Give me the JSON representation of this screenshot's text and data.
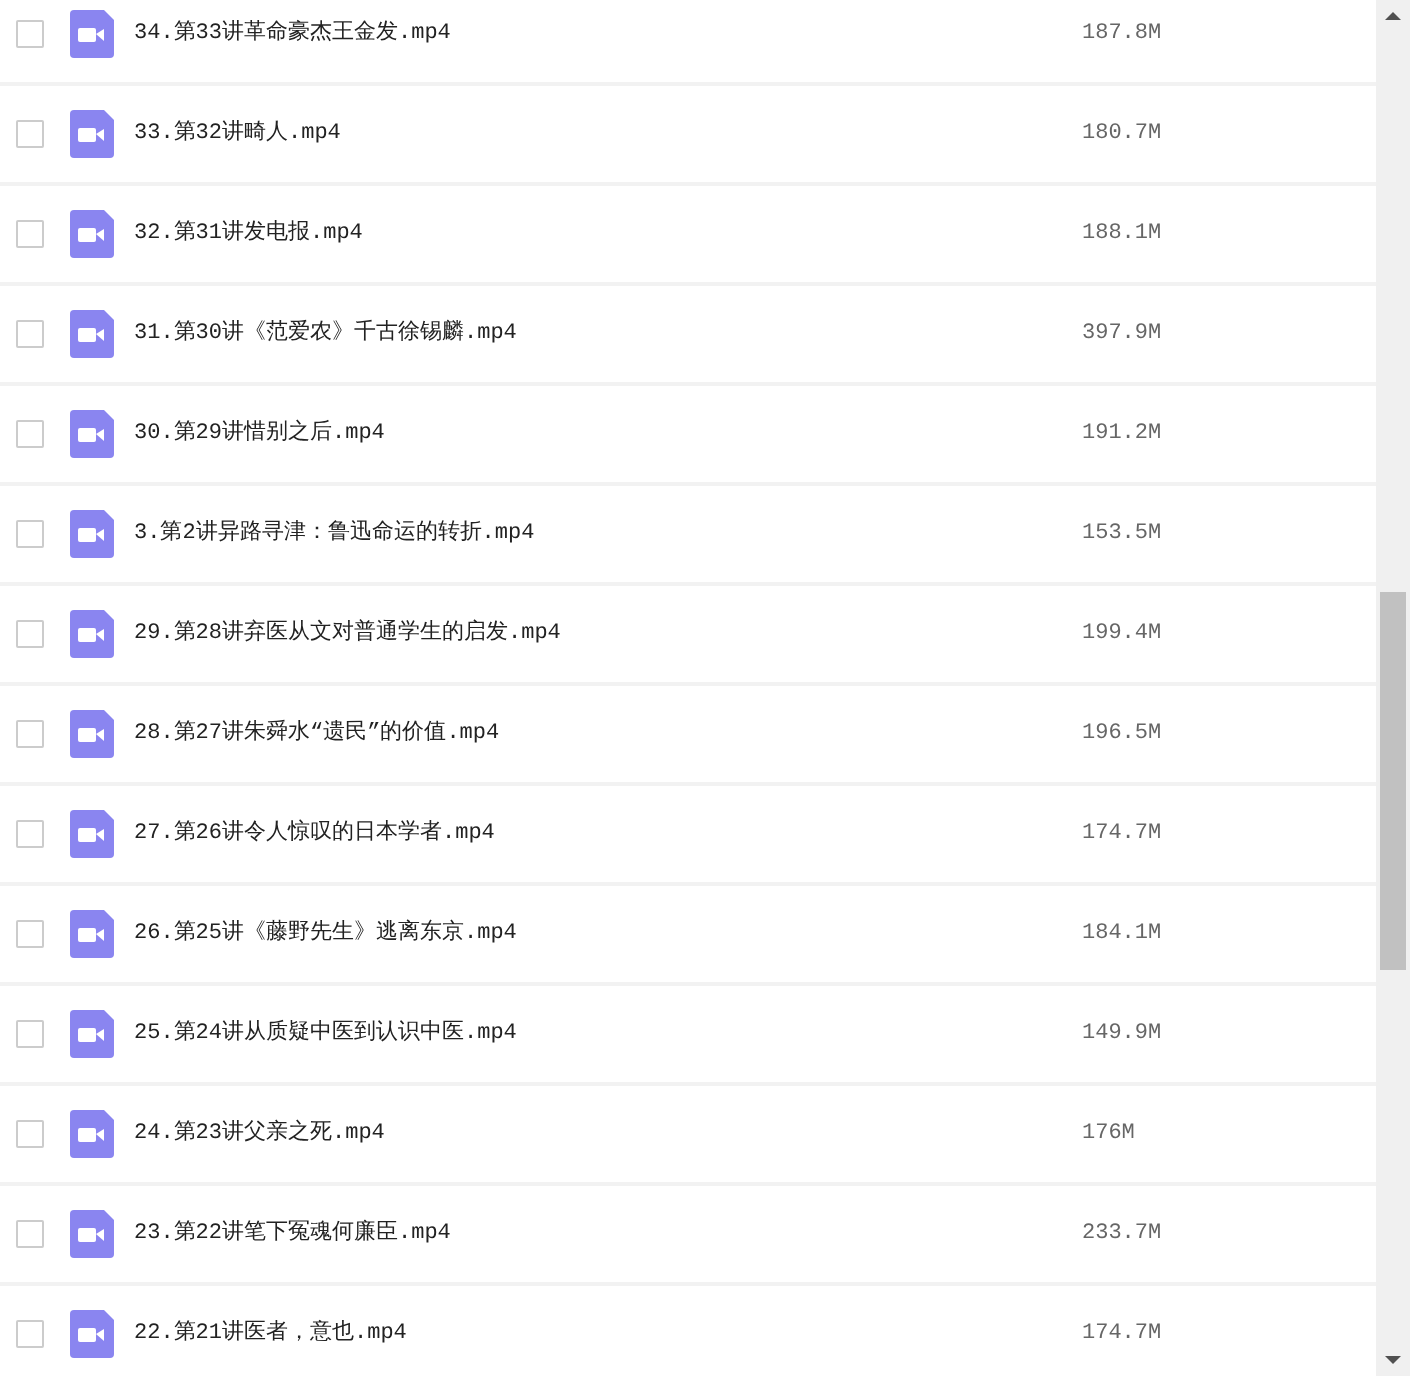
{
  "files": [
    {
      "name": "34.第33讲革命豪杰王金发.mp4",
      "size": "187.8M",
      "checked": false
    },
    {
      "name": "33.第32讲畸人.mp4",
      "size": "180.7M",
      "checked": false
    },
    {
      "name": "32.第31讲发电报.mp4",
      "size": "188.1M",
      "checked": false
    },
    {
      "name": "31.第30讲《范爱农》千古徐锡麟.mp4",
      "size": "397.9M",
      "checked": false
    },
    {
      "name": "30.第29讲惜别之后.mp4",
      "size": "191.2M",
      "checked": false
    },
    {
      "name": "3.第2讲异路寻津：鲁迅命运的转折.mp4",
      "size": "153.5M",
      "checked": false
    },
    {
      "name": "29.第28讲弃医从文对普通学生的启发.mp4",
      "size": "199.4M",
      "checked": false
    },
    {
      "name": "28.第27讲朱舜水“遗民”的价值.mp4",
      "size": "196.5M",
      "checked": false
    },
    {
      "name": "27.第26讲令人惊叹的日本学者.mp4",
      "size": "174.7M",
      "checked": false
    },
    {
      "name": "26.第25讲《藤野先生》逃离东京.mp4",
      "size": "184.1M",
      "checked": false
    },
    {
      "name": "25.第24讲从质疑中医到认识中医.mp4",
      "size": "149.9M",
      "checked": false
    },
    {
      "name": "24.第23讲父亲之死.mp4",
      "size": "176M",
      "checked": false
    },
    {
      "name": "23.第22讲笔下冤魂何廉臣.mp4",
      "size": "233.7M",
      "checked": false
    },
    {
      "name": "22.第21讲医者，意也.mp4",
      "size": "174.7M",
      "checked": false
    }
  ]
}
